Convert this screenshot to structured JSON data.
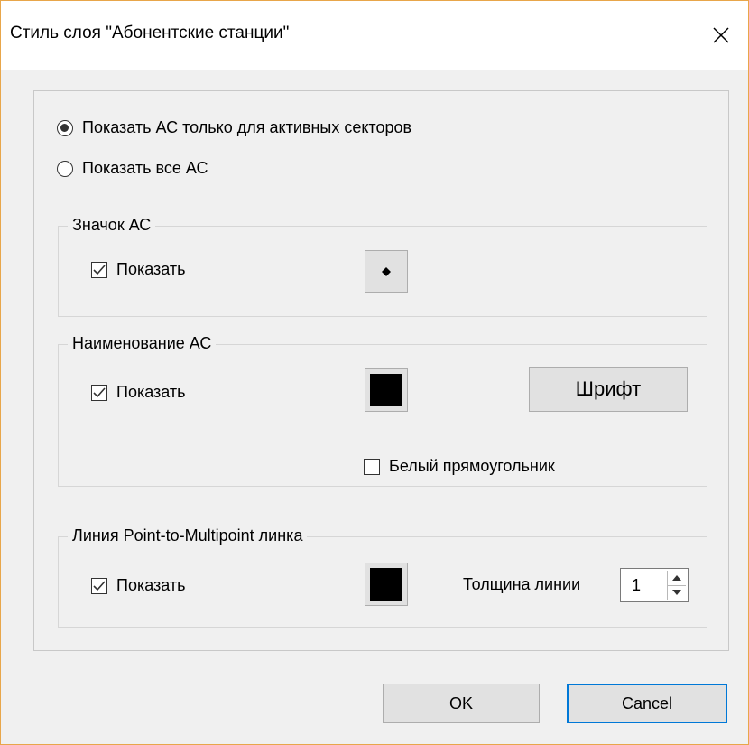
{
  "window": {
    "title": "Стиль слоя \"Абонентские станции\""
  },
  "display_mode": {
    "options": [
      {
        "label": "Показать АС только для активных секторов",
        "checked": true
      },
      {
        "label": "Показать все АС",
        "checked": false
      }
    ]
  },
  "icon_group": {
    "title": "Значок АС",
    "show_label": "Показать",
    "show_checked": true
  },
  "name_group": {
    "title": "Наименование АС",
    "show_label": "Показать",
    "show_checked": true,
    "font_button": "Шрифт",
    "white_rect_label": "Белый прямоугольник",
    "white_rect_checked": false,
    "color": "#000000"
  },
  "line_group": {
    "title": "Линия Point-to-Multipoint линка",
    "show_label": "Показать",
    "show_checked": true,
    "thickness_label": "Толщина линии",
    "thickness_value": "1",
    "color": "#000000"
  },
  "buttons": {
    "ok": "OK",
    "cancel": "Cancel"
  },
  "colors": {
    "accent": "#0078d7",
    "window_border": "#e8a64a",
    "dialog_bg": "#f0f0f0"
  }
}
